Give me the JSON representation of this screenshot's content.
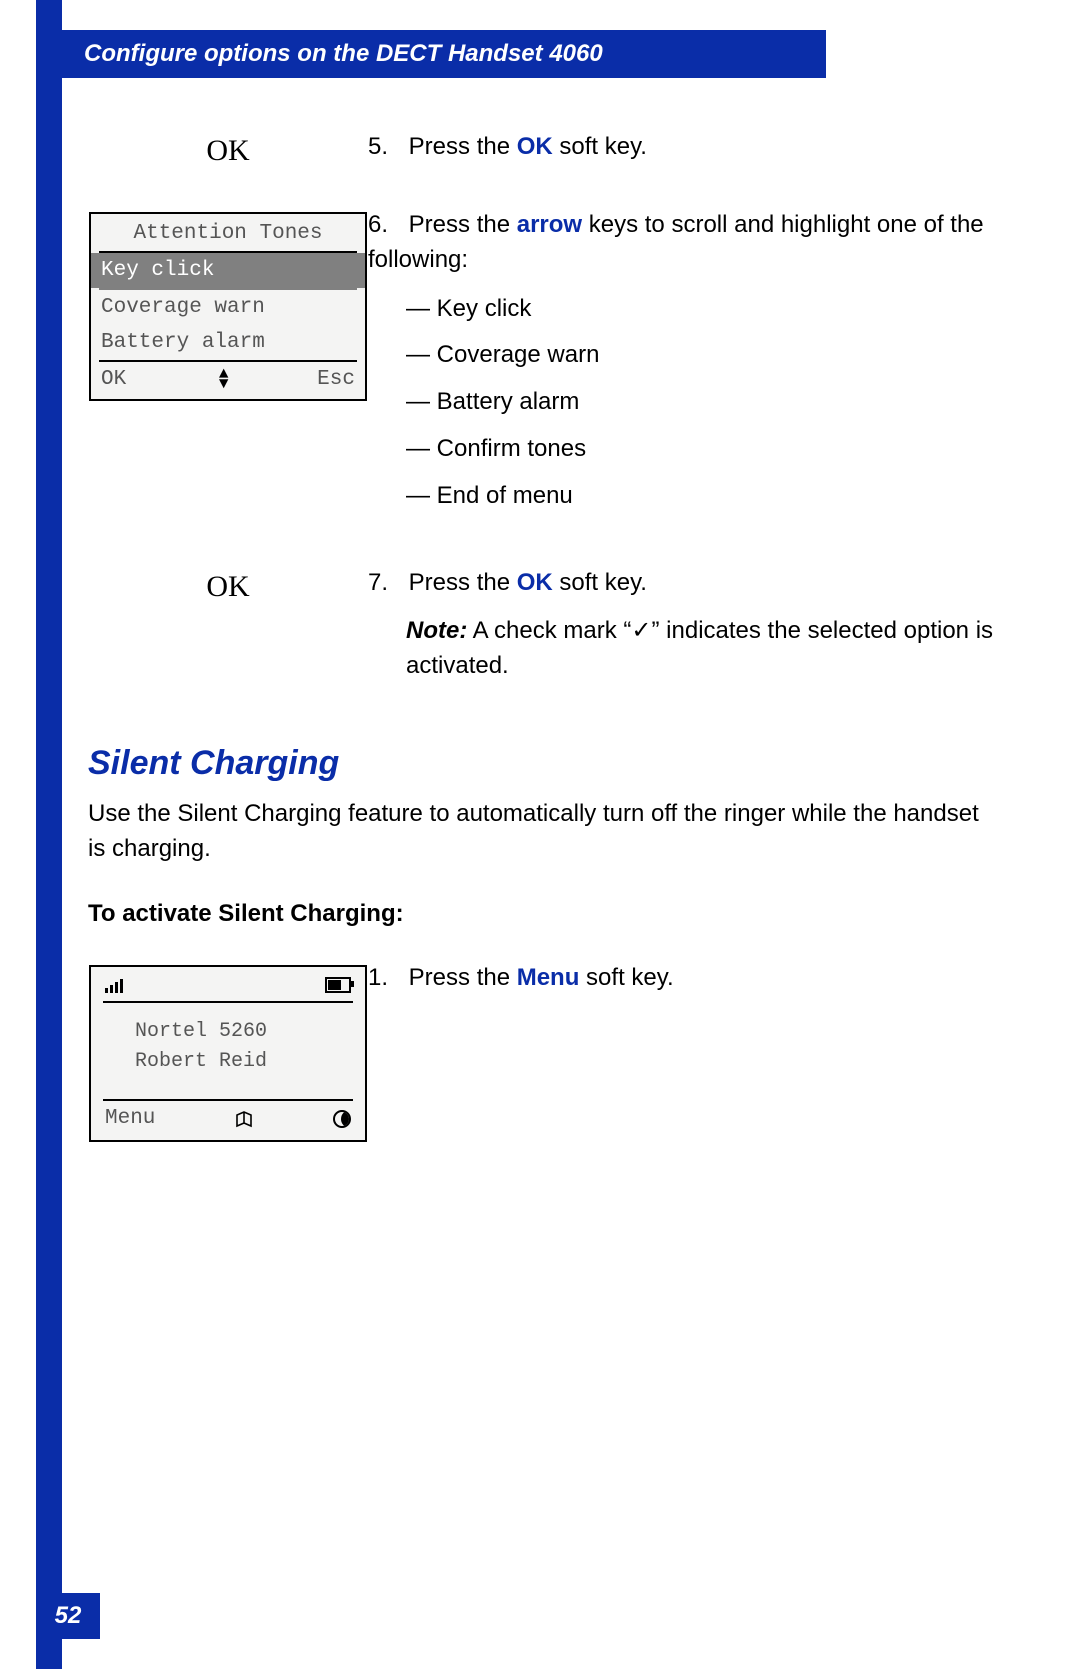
{
  "header": {
    "title": "Configure options on the DECT Handset 4060"
  },
  "steps": {
    "s5": {
      "left_label": "OK",
      "num": "5.",
      "text_a": "Press the ",
      "text_ok": "OK",
      "text_b": " soft key."
    },
    "s6": {
      "num": "6.",
      "text_a": "Press the ",
      "text_arrow": "arrow",
      "text_b": " keys to scroll and highlight one of the following:",
      "options": {
        "o1": "Key click",
        "o2": "Coverage warn",
        "o3": "Battery alarm",
        "o4": "Confirm tones",
        "o5": "End of menu"
      }
    },
    "s7": {
      "left_label": "OK",
      "num": "7.",
      "text_a": "Press the ",
      "text_ok": "OK",
      "text_b": " soft key.",
      "note_label": "Note:",
      "note_a": " A check mark “",
      "note_check": "✓",
      "note_b": "” indicates the selected option is activated."
    },
    "s1b": {
      "num": "1.",
      "text_a": "Press the ",
      "text_menu": "Menu",
      "text_b": " soft key."
    }
  },
  "handset_menu": {
    "title": "Attention Tones",
    "items": {
      "i1": "Key click",
      "i2": "Coverage warn",
      "i3": "Battery alarm"
    },
    "soft_left": "OK",
    "soft_right": "Esc"
  },
  "idle_screen": {
    "line1": "Nortel 5260",
    "line2": "Robert Reid",
    "soft_left": "Menu"
  },
  "section": {
    "heading": "Silent Charging",
    "intro": "Use the Silent Charging feature to automatically turn off the ringer while the handset is charging.",
    "activate": "To activate Silent Charging:"
  },
  "page_number": "52"
}
